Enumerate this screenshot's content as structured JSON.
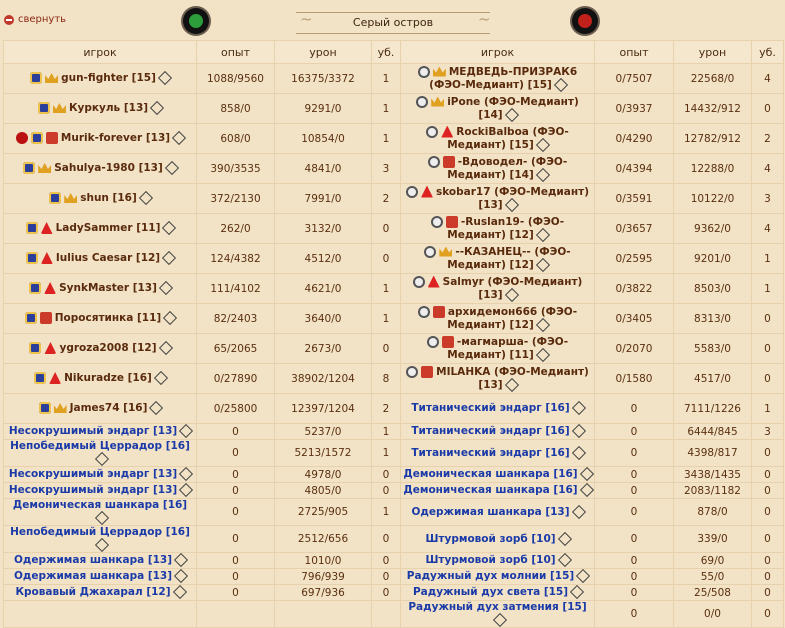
{
  "header": {
    "collapse_label": "свернуть",
    "title": "Серый остров"
  },
  "columns": {
    "player": "игрок",
    "exp": "опыт",
    "damage": "урон",
    "kills": "уб."
  },
  "rows": [
    {
      "l": {
        "name": "gun-fighter [15]",
        "icons": [
          "i-shield",
          "i-crown"
        ],
        "exp": "1088/9560",
        "dmg": "16375/3372",
        "kills": "1",
        "bot": false
      },
      "r": {
        "name": "МЕДВЕДЬ-ПРИЗРАК6 (ФЭО-Медиант) [15]",
        "icons": [
          "i-badge",
          "i-crown"
        ],
        "exp": "0/7507",
        "dmg": "22568/0",
        "kills": "4",
        "bot": false
      }
    },
    {
      "l": {
        "name": "Куркуль [13]",
        "icons": [
          "i-shield",
          "i-crown"
        ],
        "exp": "858/0",
        "dmg": "9291/0",
        "kills": "1",
        "bot": false
      },
      "r": {
        "name": "iPone (ФЭО-Медиант) [14]",
        "icons": [
          "i-badge",
          "i-crown"
        ],
        "exp": "0/3937",
        "dmg": "14432/912",
        "kills": "0",
        "bot": false
      }
    },
    {
      "l": {
        "name": "Murik-forever [13]",
        "icons": [
          "i-skull",
          "i-shield",
          "i-mask"
        ],
        "exp": "608/0",
        "dmg": "10854/0",
        "kills": "1",
        "bot": false
      },
      "r": {
        "name": "RockiBalboa (ФЭО-Медиант) [15]",
        "icons": [
          "i-badge",
          "i-mont"
        ],
        "exp": "0/4290",
        "dmg": "12782/912",
        "kills": "2",
        "bot": false
      }
    },
    {
      "l": {
        "name": "Sahulya-1980 [13]",
        "icons": [
          "i-shield",
          "i-crown"
        ],
        "exp": "390/3535",
        "dmg": "4841/0",
        "kills": "3",
        "bot": false
      },
      "r": {
        "name": "-Вдоводел- (ФЭО-Медиант) [14]",
        "icons": [
          "i-badge",
          "i-mask"
        ],
        "exp": "0/4394",
        "dmg": "12288/0",
        "kills": "4",
        "bot": false
      }
    },
    {
      "l": {
        "name": "shun [16]",
        "icons": [
          "i-shield",
          "i-crown"
        ],
        "exp": "372/2130",
        "dmg": "7991/0",
        "kills": "2",
        "bot": false
      },
      "r": {
        "name": "skobar17 (ФЭО-Медиант) [13]",
        "icons": [
          "i-badge",
          "i-mont"
        ],
        "exp": "0/3591",
        "dmg": "10122/0",
        "kills": "3",
        "bot": false
      }
    },
    {
      "l": {
        "name": "LadySammer [11]",
        "icons": [
          "i-shield",
          "i-mont"
        ],
        "exp": "262/0",
        "dmg": "3132/0",
        "kills": "0",
        "bot": false
      },
      "r": {
        "name": "-Ruslan19- (ФЭО-Медиант) [12]",
        "icons": [
          "i-badge",
          "i-mask"
        ],
        "exp": "0/3657",
        "dmg": "9362/0",
        "kills": "4",
        "bot": false
      }
    },
    {
      "l": {
        "name": "Iulius Caesar [12]",
        "icons": [
          "i-shield",
          "i-mont"
        ],
        "exp": "124/4382",
        "dmg": "4512/0",
        "kills": "0",
        "bot": false
      },
      "r": {
        "name": "--КАЗАНЕЦ-- (ФЭО-Медиант) [12]",
        "icons": [
          "i-badge",
          "i-crown"
        ],
        "exp": "0/2595",
        "dmg": "9201/0",
        "kills": "1",
        "bot": false
      }
    },
    {
      "l": {
        "name": "SynkMaster [13]",
        "icons": [
          "i-shield",
          "i-mont"
        ],
        "exp": "111/4102",
        "dmg": "4621/0",
        "kills": "1",
        "bot": false
      },
      "r": {
        "name": "Salmyr (ФЭО-Медиант) [13]",
        "icons": [
          "i-badge",
          "i-mont"
        ],
        "exp": "0/3822",
        "dmg": "8503/0",
        "kills": "1",
        "bot": false
      }
    },
    {
      "l": {
        "name": "Поросятинка [11]",
        "icons": [
          "i-shield",
          "i-mask"
        ],
        "exp": "82/2403",
        "dmg": "3640/0",
        "kills": "1",
        "bot": false
      },
      "r": {
        "name": "архидемон666 (ФЭО-Медиант) [12]",
        "icons": [
          "i-badge",
          "i-mask"
        ],
        "exp": "0/3405",
        "dmg": "8313/0",
        "kills": "0",
        "bot": false
      }
    },
    {
      "l": {
        "name": "ygroza2008 [12]",
        "icons": [
          "i-shield",
          "i-mont"
        ],
        "exp": "65/2065",
        "dmg": "2673/0",
        "kills": "0",
        "bot": false
      },
      "r": {
        "name": "-магмарша- (ФЭО-Медиант) [11]",
        "icons": [
          "i-badge",
          "i-mask"
        ],
        "exp": "0/2070",
        "dmg": "5583/0",
        "kills": "0",
        "bot": false
      }
    },
    {
      "l": {
        "name": "Nikuradze [16]",
        "icons": [
          "i-shield",
          "i-mont"
        ],
        "exp": "0/27890",
        "dmg": "38902/1204",
        "kills": "8",
        "bot": false
      },
      "r": {
        "name": "MILAHKA (ФЭО-Медиант) [13]",
        "icons": [
          "i-badge",
          "i-mask"
        ],
        "exp": "0/1580",
        "dmg": "4517/0",
        "kills": "0",
        "bot": false
      }
    },
    {
      "l": {
        "name": "James74 [16]",
        "icons": [
          "i-shield",
          "i-crown"
        ],
        "exp": "0/25800",
        "dmg": "12397/1204",
        "kills": "2",
        "bot": false
      },
      "r": {
        "name": "Титанический эндарг [16]",
        "icons": [],
        "exp": "0",
        "dmg": "7111/1226",
        "kills": "1",
        "bot": true
      }
    },
    {
      "l": {
        "name": "Несокрушимый эндарг [13]",
        "icons": [],
        "exp": "0",
        "dmg": "5237/0",
        "kills": "1",
        "bot": true
      },
      "r": {
        "name": "Титанический эндарг [16]",
        "icons": [],
        "exp": "0",
        "dmg": "6444/845",
        "kills": "3",
        "bot": true
      }
    },
    {
      "l": {
        "name": "Непобедимый Церрадор [16]",
        "icons": [],
        "exp": "0",
        "dmg": "5213/1572",
        "kills": "1",
        "bot": true
      },
      "r": {
        "name": "Титанический эндарг [16]",
        "icons": [],
        "exp": "0",
        "dmg": "4398/817",
        "kills": "0",
        "bot": true
      }
    },
    {
      "l": {
        "name": "Несокрушимый эндарг [13]",
        "icons": [],
        "exp": "0",
        "dmg": "4978/0",
        "kills": "0",
        "bot": true
      },
      "r": {
        "name": "Демоническая шанкара [16]",
        "icons": [],
        "exp": "0",
        "dmg": "3438/1435",
        "kills": "0",
        "bot": true
      }
    },
    {
      "l": {
        "name": "Несокрушимый эндарг [13]",
        "icons": [],
        "exp": "0",
        "dmg": "4805/0",
        "kills": "0",
        "bot": true
      },
      "r": {
        "name": "Демоническая шанкара [16]",
        "icons": [],
        "exp": "0",
        "dmg": "2083/1182",
        "kills": "0",
        "bot": true
      }
    },
    {
      "l": {
        "name": "Демоническая шанкара [16]",
        "icons": [],
        "exp": "0",
        "dmg": "2725/905",
        "kills": "1",
        "bot": true
      },
      "r": {
        "name": "Одержимая шанкара [13]",
        "icons": [],
        "exp": "0",
        "dmg": "878/0",
        "kills": "0",
        "bot": true
      }
    },
    {
      "l": {
        "name": "Непобедимый Церрадор [16]",
        "icons": [],
        "exp": "0",
        "dmg": "2512/656",
        "kills": "0",
        "bot": true
      },
      "r": {
        "name": "Штурмовой зорб [10]",
        "icons": [],
        "exp": "0",
        "dmg": "339/0",
        "kills": "0",
        "bot": true
      }
    },
    {
      "l": {
        "name": "Одержимая шанкара [13]",
        "icons": [],
        "exp": "0",
        "dmg": "1010/0",
        "kills": "0",
        "bot": true
      },
      "r": {
        "name": "Штурмовой зорб [10]",
        "icons": [],
        "exp": "0",
        "dmg": "69/0",
        "kills": "0",
        "bot": true
      }
    },
    {
      "l": {
        "name": "Одержимая шанкара [13]",
        "icons": [],
        "exp": "0",
        "dmg": "796/939",
        "kills": "0",
        "bot": true
      },
      "r": {
        "name": "Радужный дух молнии [15]",
        "icons": [],
        "exp": "0",
        "dmg": "55/0",
        "kills": "0",
        "bot": true
      }
    },
    {
      "l": {
        "name": "Кровавый Джахарал [12]",
        "icons": [],
        "exp": "0",
        "dmg": "697/936",
        "kills": "0",
        "bot": true
      },
      "r": {
        "name": "Радужный дух света [15]",
        "icons": [],
        "exp": "0",
        "dmg": "25/508",
        "kills": "0",
        "bot": true
      }
    },
    {
      "l": null,
      "r": {
        "name": "Радужный дух затмения [15]",
        "icons": [],
        "exp": "0",
        "dmg": "0/0",
        "kills": "0",
        "bot": true
      }
    }
  ]
}
